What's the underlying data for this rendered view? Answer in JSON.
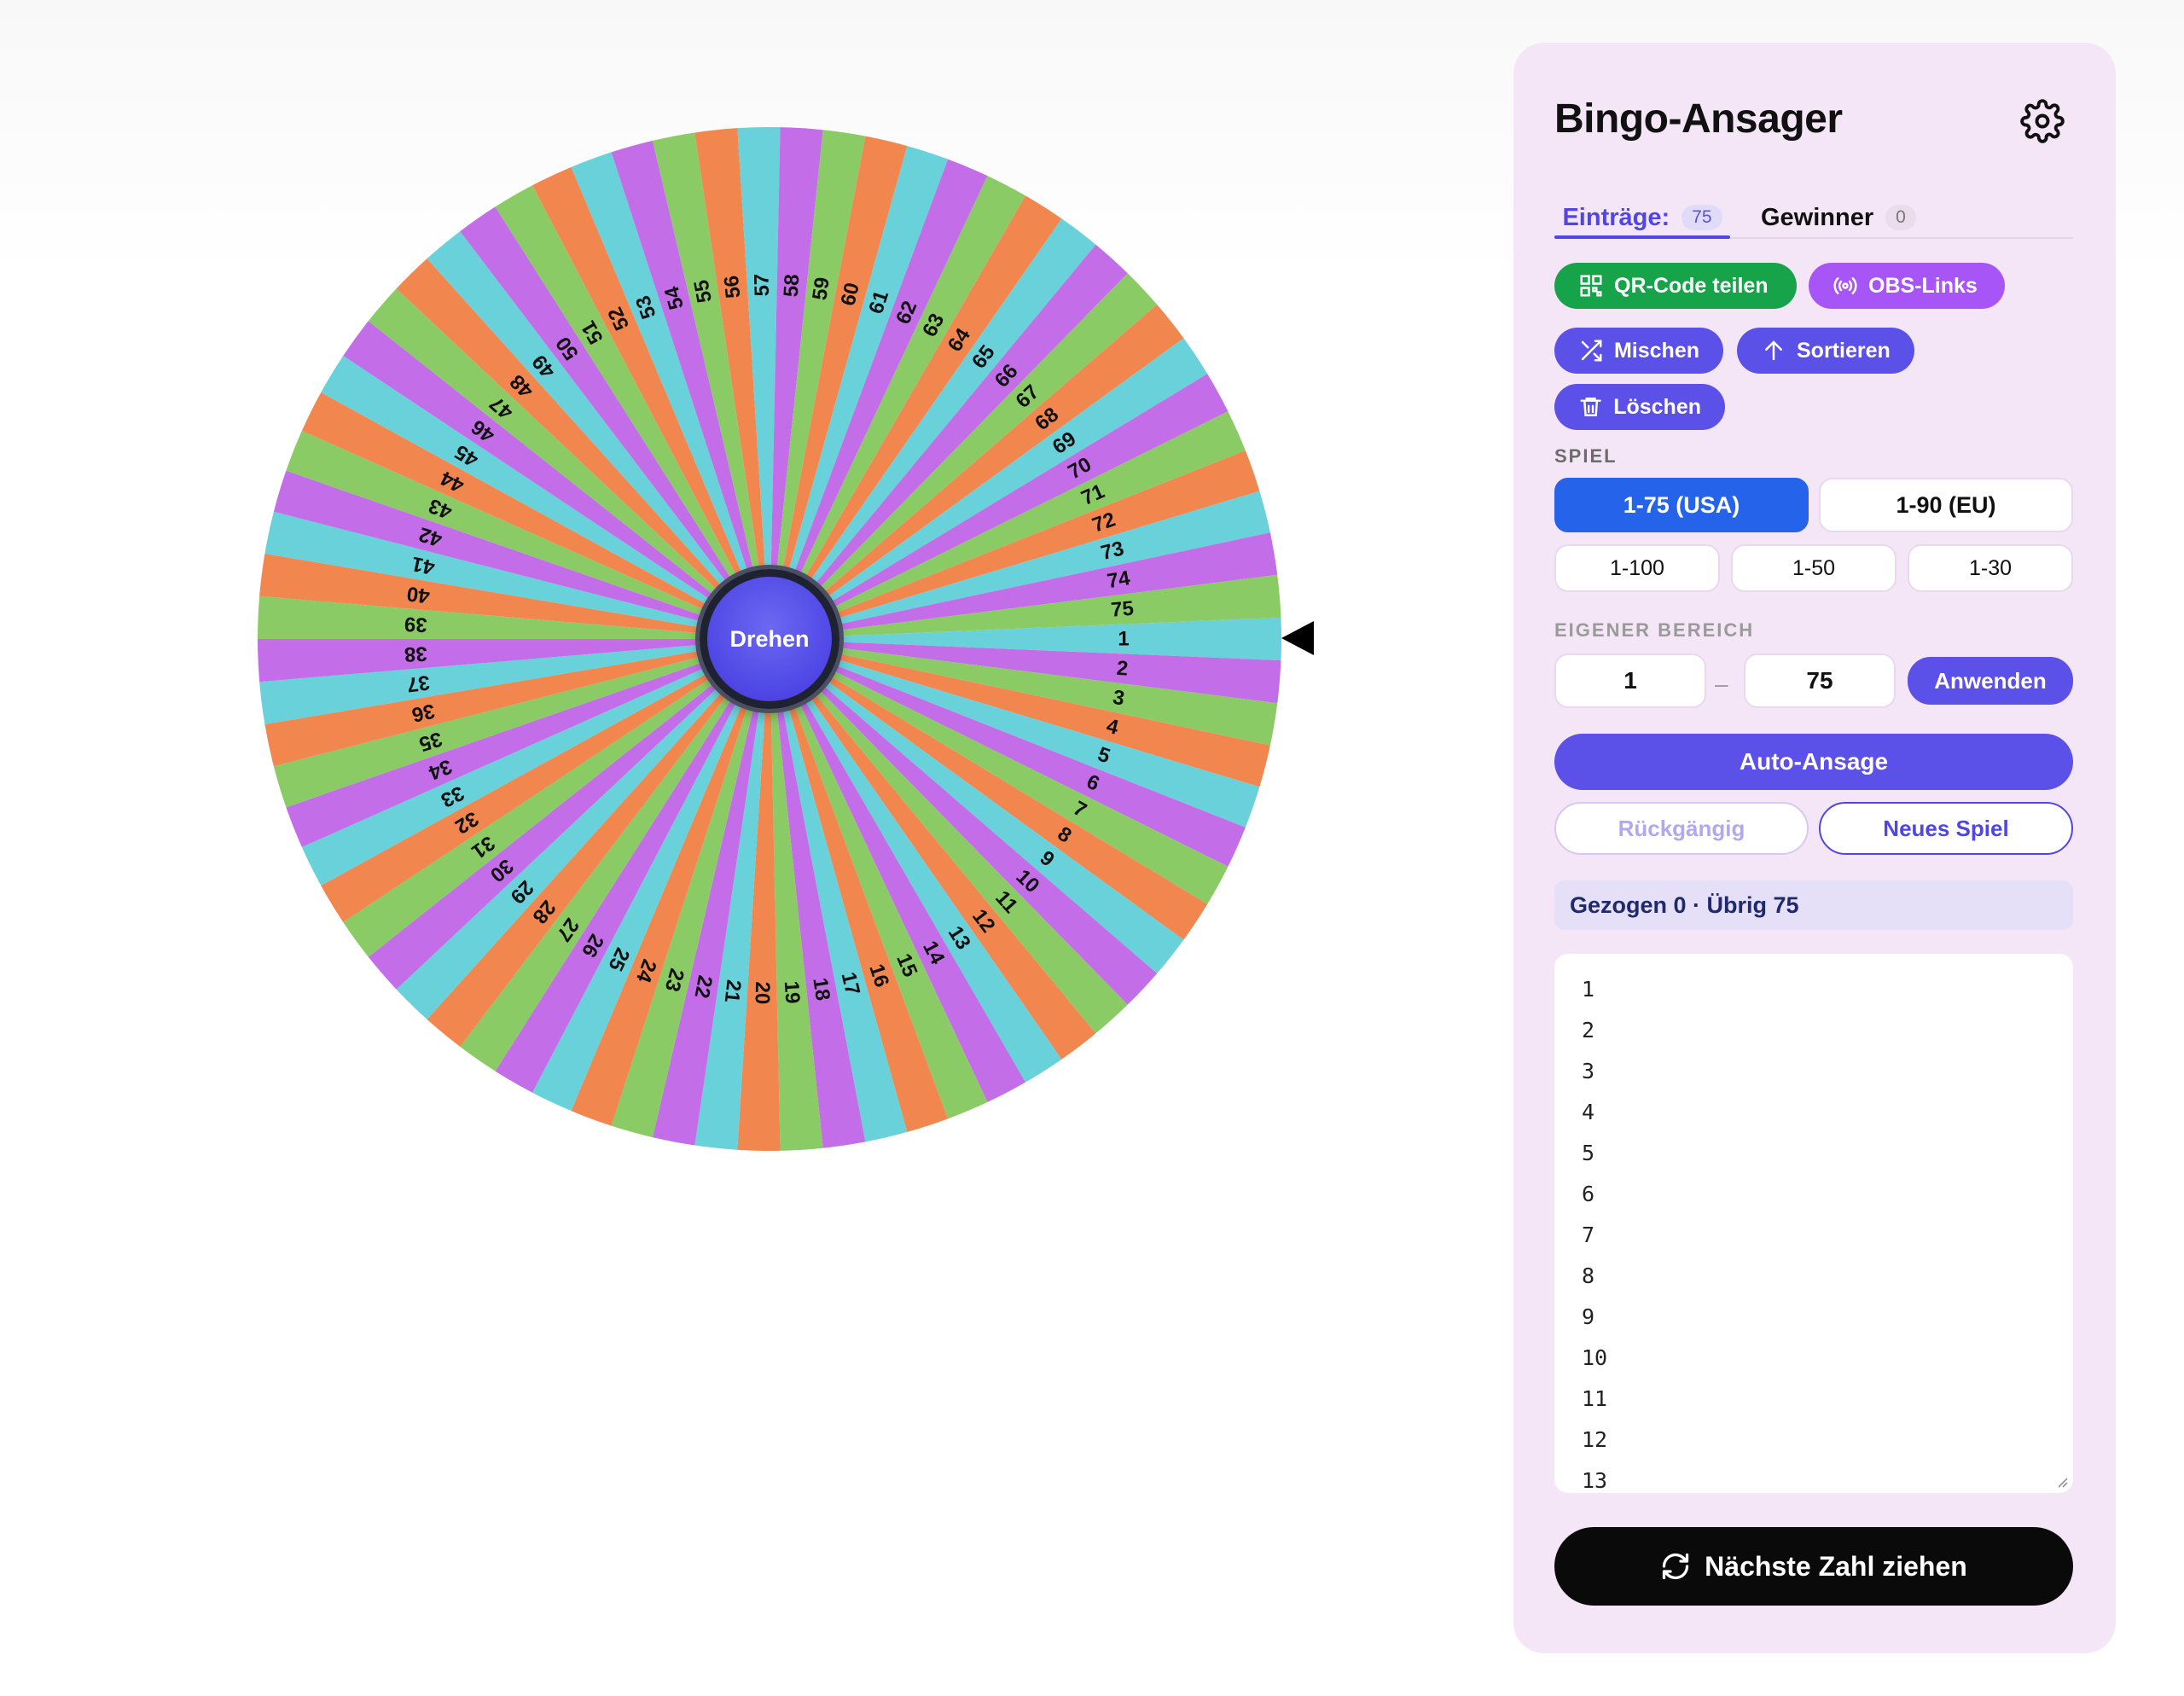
{
  "wheel": {
    "spin_label": "Drehen",
    "numbers": [
      1,
      2,
      3,
      4,
      5,
      6,
      7,
      8,
      9,
      10,
      11,
      12,
      13,
      14,
      15,
      16,
      17,
      18,
      19,
      20,
      21,
      22,
      23,
      24,
      25,
      26,
      27,
      28,
      29,
      30,
      31,
      32,
      33,
      34,
      35,
      36,
      37,
      38,
      39,
      40,
      41,
      42,
      43,
      44,
      45,
      46,
      47,
      48,
      49,
      50,
      51,
      52,
      53,
      54,
      55,
      56,
      57,
      58,
      59,
      60,
      61,
      62,
      63,
      64,
      65,
      66,
      67,
      68,
      69,
      70,
      71,
      72,
      73,
      74,
      75
    ],
    "segment_colors": [
      "#68d1d9",
      "#c36ee8",
      "#8bcb66",
      "#f2864f"
    ]
  },
  "panel": {
    "title": "Bingo-Ansager",
    "tabs": [
      {
        "label": "Einträge:",
        "count": "75"
      },
      {
        "label": "Gewinner",
        "count": "0"
      }
    ],
    "actions": {
      "qr": "QR-Code teilen",
      "obs": "OBS-Links",
      "shuffle": "Mischen",
      "sort": "Sortieren",
      "delete": "Löschen"
    },
    "game_label": "SPIEL",
    "game_options": [
      "1-75 (USA)",
      "1-90 (EU)",
      "1-100",
      "1-50",
      "1-30"
    ],
    "selected_game": "1-75 (USA)",
    "custom_range": {
      "label": "EIGENER BEREICH",
      "from": "1",
      "to": "75",
      "separator": "–",
      "apply": "Anwenden"
    },
    "auto_call": "Auto-Ansage",
    "undo": "Rückgängig",
    "new_game": "Neues Spiel",
    "status": "Gezogen 0 · Übrig 75",
    "entries_visible": [
      "1",
      "2",
      "3",
      "4",
      "5",
      "6",
      "7",
      "8",
      "9",
      "10",
      "11",
      "12",
      "13"
    ],
    "draw_button": "Nächste Zahl ziehen"
  },
  "icons": [
    "gear-icon",
    "qr-code-icon",
    "broadcast-icon",
    "shuffle-icon",
    "arrow-up-icon",
    "trash-icon",
    "refresh-icon",
    "pointer-arrow-icon"
  ]
}
